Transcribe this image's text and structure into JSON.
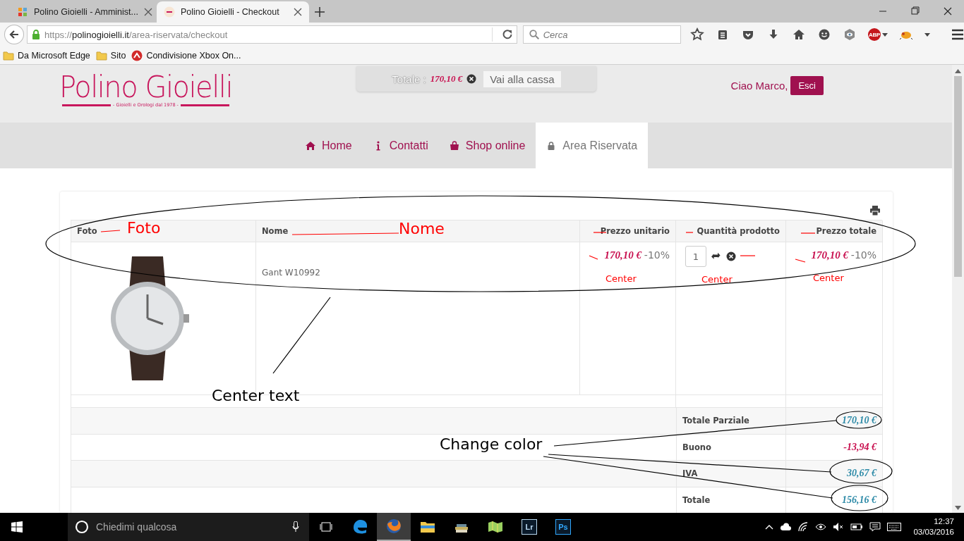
{
  "browser": {
    "tabs": [
      {
        "title": "Polino Gioielli - Amminist...",
        "selected": false
      },
      {
        "title": "Polino Gioielli - Checkout",
        "selected": true
      }
    ],
    "url": {
      "scheme": "https://",
      "domain": "polinogioielli.it",
      "path": "/area-riservata/checkout"
    },
    "search": {
      "placeholder": "Cerca"
    },
    "adblock_badge": "ABP",
    "bookmarks": [
      "Da Microsoft Edge",
      "Sito",
      "Condivisione Xbox On..."
    ]
  },
  "site": {
    "logo": {
      "name": "Polino Gioielli",
      "tagline": "- Gioielli e Orologi dal 1978 -"
    },
    "cart": {
      "label": "Totale :",
      "amount": "170,10 €",
      "button": "Vai alla cassa"
    },
    "greeting": "Ciao Marco,",
    "logout": "Esci",
    "menu": [
      {
        "label": "Home",
        "kind": "home",
        "selected": false
      },
      {
        "label": "Contatti",
        "kind": "info",
        "selected": false
      },
      {
        "label": "Shop online",
        "kind": "bag",
        "selected": false
      },
      {
        "label": "Area Riservata",
        "kind": "lock",
        "selected": true
      }
    ]
  },
  "cart_table": {
    "columns": [
      "Foto",
      "Nome",
      "Prezzo unitario",
      "Quantità prodotto",
      "Prezzo totale"
    ],
    "rows": [
      {
        "name": "Gant W10992",
        "unit_price": "170,10 €",
        "unit_discount": "-10%",
        "quantity": "1",
        "total_price": "170,10 €",
        "total_discount": "-10%"
      }
    ],
    "summary": [
      {
        "label": "Totale Parziale",
        "value": "170,10 €",
        "color": "#2e8ba8"
      },
      {
        "label": "Buono",
        "value": "-13,94 €",
        "color": "#c8104f"
      },
      {
        "label": "IVA",
        "value": "30,67 €",
        "color": "#2e8ba8"
      },
      {
        "label": "Totale",
        "value": "156,16 €",
        "color": "#2e8ba8"
      }
    ]
  },
  "annotations": [
    {
      "text": "Foto",
      "color": "#ff0000"
    },
    {
      "text": "Nome",
      "color": "#ff0000"
    },
    {
      "text": "Center",
      "color": "#ff0000"
    },
    {
      "text": "Center",
      "color": "#ff0000"
    },
    {
      "text": "Center",
      "color": "#ff0000"
    },
    {
      "text": "Center text",
      "color": "#000000"
    },
    {
      "text": "Change color",
      "color": "#000000"
    }
  ],
  "taskbar": {
    "search_placeholder": "Chiedimi qualcosa",
    "apps": [
      "Lr",
      "Ps"
    ],
    "time": "12:37",
    "date": "03/03/2016"
  }
}
